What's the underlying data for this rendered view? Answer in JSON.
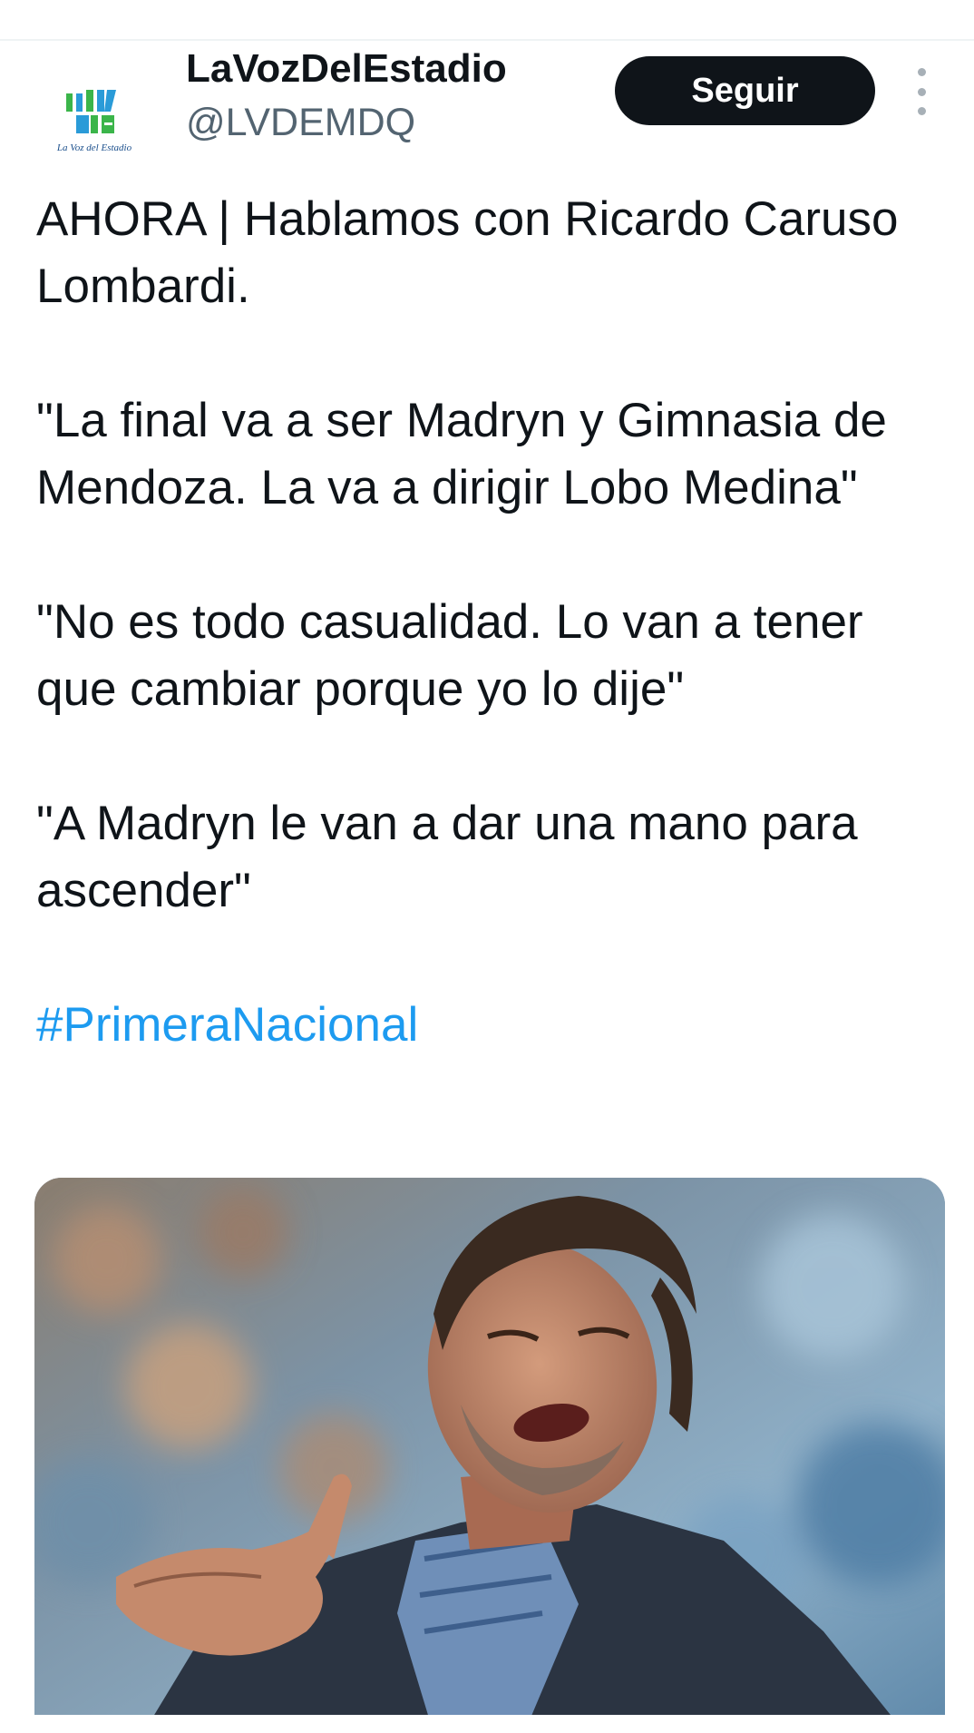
{
  "account": {
    "display_name": "LaVozDelEstadio",
    "handle": "@LVDEMDQ",
    "avatar_caption": "La Voz del Estadio",
    "avatar_letters": "LVDE"
  },
  "actions": {
    "follow_label": "Seguir"
  },
  "tweet": {
    "paragraphs": [
      "AHORA | Hablamos con Ricardo Caruso Lombardi.",
      "\"La final va a ser Madryn y Gimnasia de Mendoza. La va a dirigir Lobo Medina\"",
      "\"No es todo casualidad. Lo van a tener que cambiar porque yo lo dije\"",
      "\"A Madryn le van a dar una mano para ascender\""
    ],
    "hashtag": "#PrimeraNacional"
  },
  "colors": {
    "link": "#1d9bf0",
    "follow_button_bg": "#0f1419",
    "secondary_text": "#536471"
  }
}
